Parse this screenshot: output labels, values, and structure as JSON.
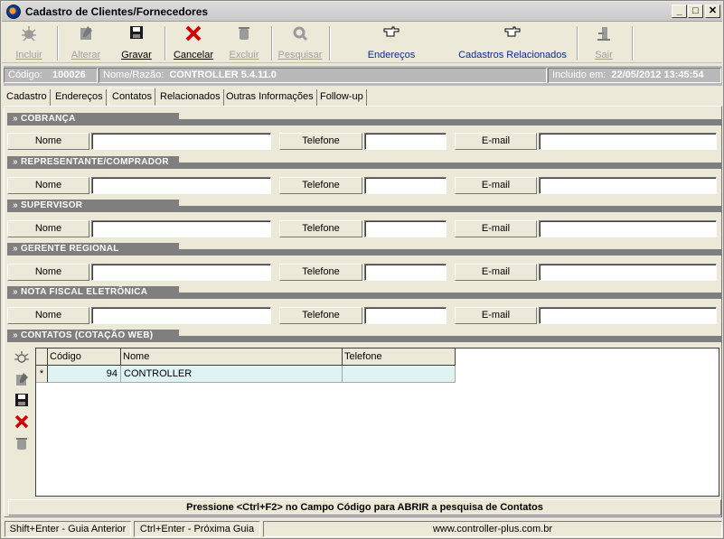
{
  "window": {
    "title": "Cadastro de Clientes/Fornecedores",
    "min_glyph": "_",
    "max_glyph": "□",
    "close_glyph": "✕"
  },
  "toolbar": {
    "incluir": "Incluir",
    "alterar": "Alterar",
    "gravar": "Gravar",
    "cancelar": "Cancelar",
    "excluir": "Excluir",
    "pesquisar": "Pesquisar",
    "enderecos": "Endereços",
    "cadastros_relacionados": "Cadastros Relacionados",
    "sair": "Sair"
  },
  "info": {
    "codigo_label": "Código:",
    "codigo_value": "100026",
    "nome_label": "Nome/Razão:",
    "nome_value": "CONTROLLER 5.4.11.0",
    "incluido_label": "Incluido em:",
    "incluido_value": "22/05/2012 13:45:54"
  },
  "tabs": [
    "Cadastro",
    "Endereços",
    "Contatos",
    "Relacionados",
    "Outras Informações",
    "Follow-up"
  ],
  "active_tab": "Contatos",
  "sections": [
    {
      "title": "» COBRANÇA",
      "nome": "Nome",
      "telefone": "Telefone",
      "email": "E-mail"
    },
    {
      "title": "» REPRESENTANTE/COMPRADOR",
      "nome": "Nome",
      "telefone": "Telefone",
      "email": "E-mail"
    },
    {
      "title": "» SUPERVISOR",
      "nome": "Nome",
      "telefone": "Telefone",
      "email": "E-mail"
    },
    {
      "title": "» GERENTE REGIONAL",
      "nome": "Nome",
      "telefone": "Telefone",
      "email": "E-mail"
    },
    {
      "title": "» NOTA FISCAL ELETRÔNICA",
      "nome": "Nome",
      "telefone": "Telefone",
      "email": "E-mail"
    }
  ],
  "contatos": {
    "title": "» CONTATOS (COTAÇÃO WEB)",
    "columns": [
      "Código",
      "Nome",
      "Telefone"
    ],
    "row_marker": "*",
    "rows": [
      {
        "codigo": "94",
        "nome": "CONTROLLER",
        "telefone": ""
      }
    ]
  },
  "hint": "Pressione <Ctrl+F2> no Campo Código para ABRIR a pesquisa de Contatos",
  "status": {
    "prev": "Shift+Enter - Guia Anterior",
    "next": "Ctrl+Enter - Próxima Guia",
    "url": "www.controller-plus.com.br"
  },
  "icons": {
    "incluir": "bug-plus-icon",
    "alterar": "edit-icon",
    "gravar": "floppy-disk-icon",
    "cancelar": "red-x-icon",
    "excluir": "trash-icon",
    "pesquisar": "magnifier-icon",
    "enderecos": "pointing-hand-icon",
    "cadastros_relacionados": "pointing-hand-icon",
    "sair": "exit-door-icon"
  },
  "colors": {
    "section_header": "#7f7f7f",
    "grid_row": "#dff3f3",
    "cancel_red": "#d00000",
    "link_blue": "#0b2a8f"
  }
}
